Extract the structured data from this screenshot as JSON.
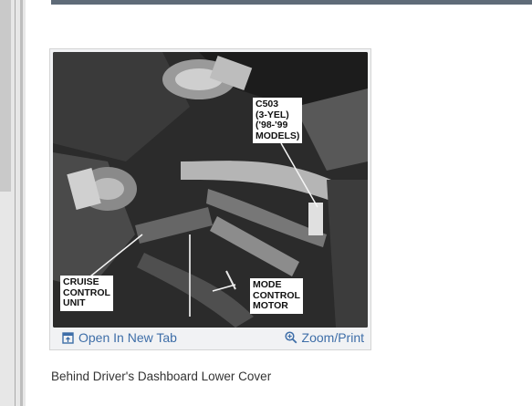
{
  "figure": {
    "callouts": {
      "connector": "C503\n(3-YEL)\n('98-'99\nMODELS)",
      "cruise_unit": "CRUISE\nCONTROL\nUNIT",
      "mode_motor": "MODE\nCONTROL\nMOTOR"
    },
    "actions": {
      "open_new_tab": "Open In New Tab",
      "open_icon": "external-window-icon",
      "zoom_print": "Zoom/Print",
      "zoom_icon": "magnifier-plus-icon"
    },
    "caption": "Behind Driver's Dashboard Lower Cover"
  },
  "colors": {
    "link": "#3e6ea8",
    "top_bar": "#5f6b78"
  }
}
